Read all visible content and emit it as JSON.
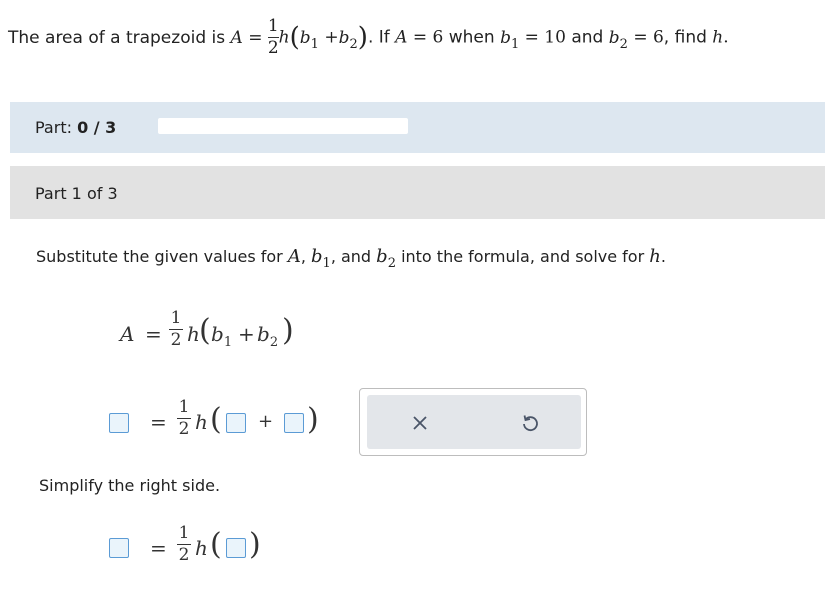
{
  "problem": {
    "intro": "The area of a trapezoid is ",
    "if_text": ". If ",
    "when_text": " when ",
    "and_text": " and ",
    "find_text": ", find ",
    "A_value": "6",
    "b1_value": "10",
    "b2_value": "6"
  },
  "progress": {
    "label": "Part: ",
    "value": "0 / 3",
    "fraction": 0
  },
  "part_header": "Part 1 of 3",
  "instruction": {
    "before": "Substitute the given values for ",
    "comma": ", ",
    "and_text": ", and ",
    "after": " into the formula, and solve for "
  },
  "simplify": "Simplify the right side.",
  "toolbox": {
    "clear_icon": "close-icon",
    "undo_icon": "undo-icon"
  }
}
